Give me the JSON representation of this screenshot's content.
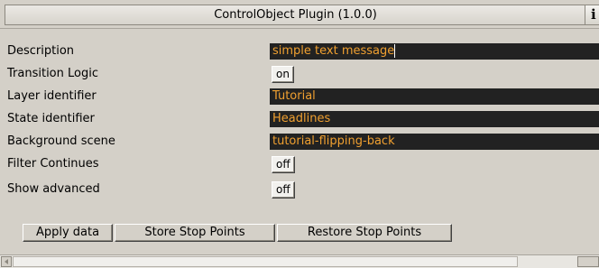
{
  "window": {
    "title": "ControlObject Plugin (1.0.0)",
    "info_label": "i"
  },
  "fields": [
    {
      "label": "Description",
      "value": "simple text message",
      "type": "text"
    },
    {
      "label": "Transition Logic",
      "value": "on",
      "type": "toggle"
    },
    {
      "label": "Layer identifier",
      "value": "Tutorial",
      "type": "text"
    },
    {
      "label": "State identifier",
      "value": "Headlines",
      "type": "text"
    },
    {
      "label": "Background scene",
      "value": "tutorial-flipping-back",
      "type": "text"
    },
    {
      "label": "Filter Continues",
      "value": "off",
      "type": "toggle"
    },
    {
      "label": "Show advanced",
      "value": "off",
      "type": "toggle"
    }
  ],
  "buttons": {
    "apply": "Apply data",
    "store": "Store Stop Points",
    "restore": "Restore Stop Points"
  },
  "colors": {
    "panel": "#d4d0c8",
    "field_bg": "#222222",
    "field_text": "#f0a030"
  }
}
